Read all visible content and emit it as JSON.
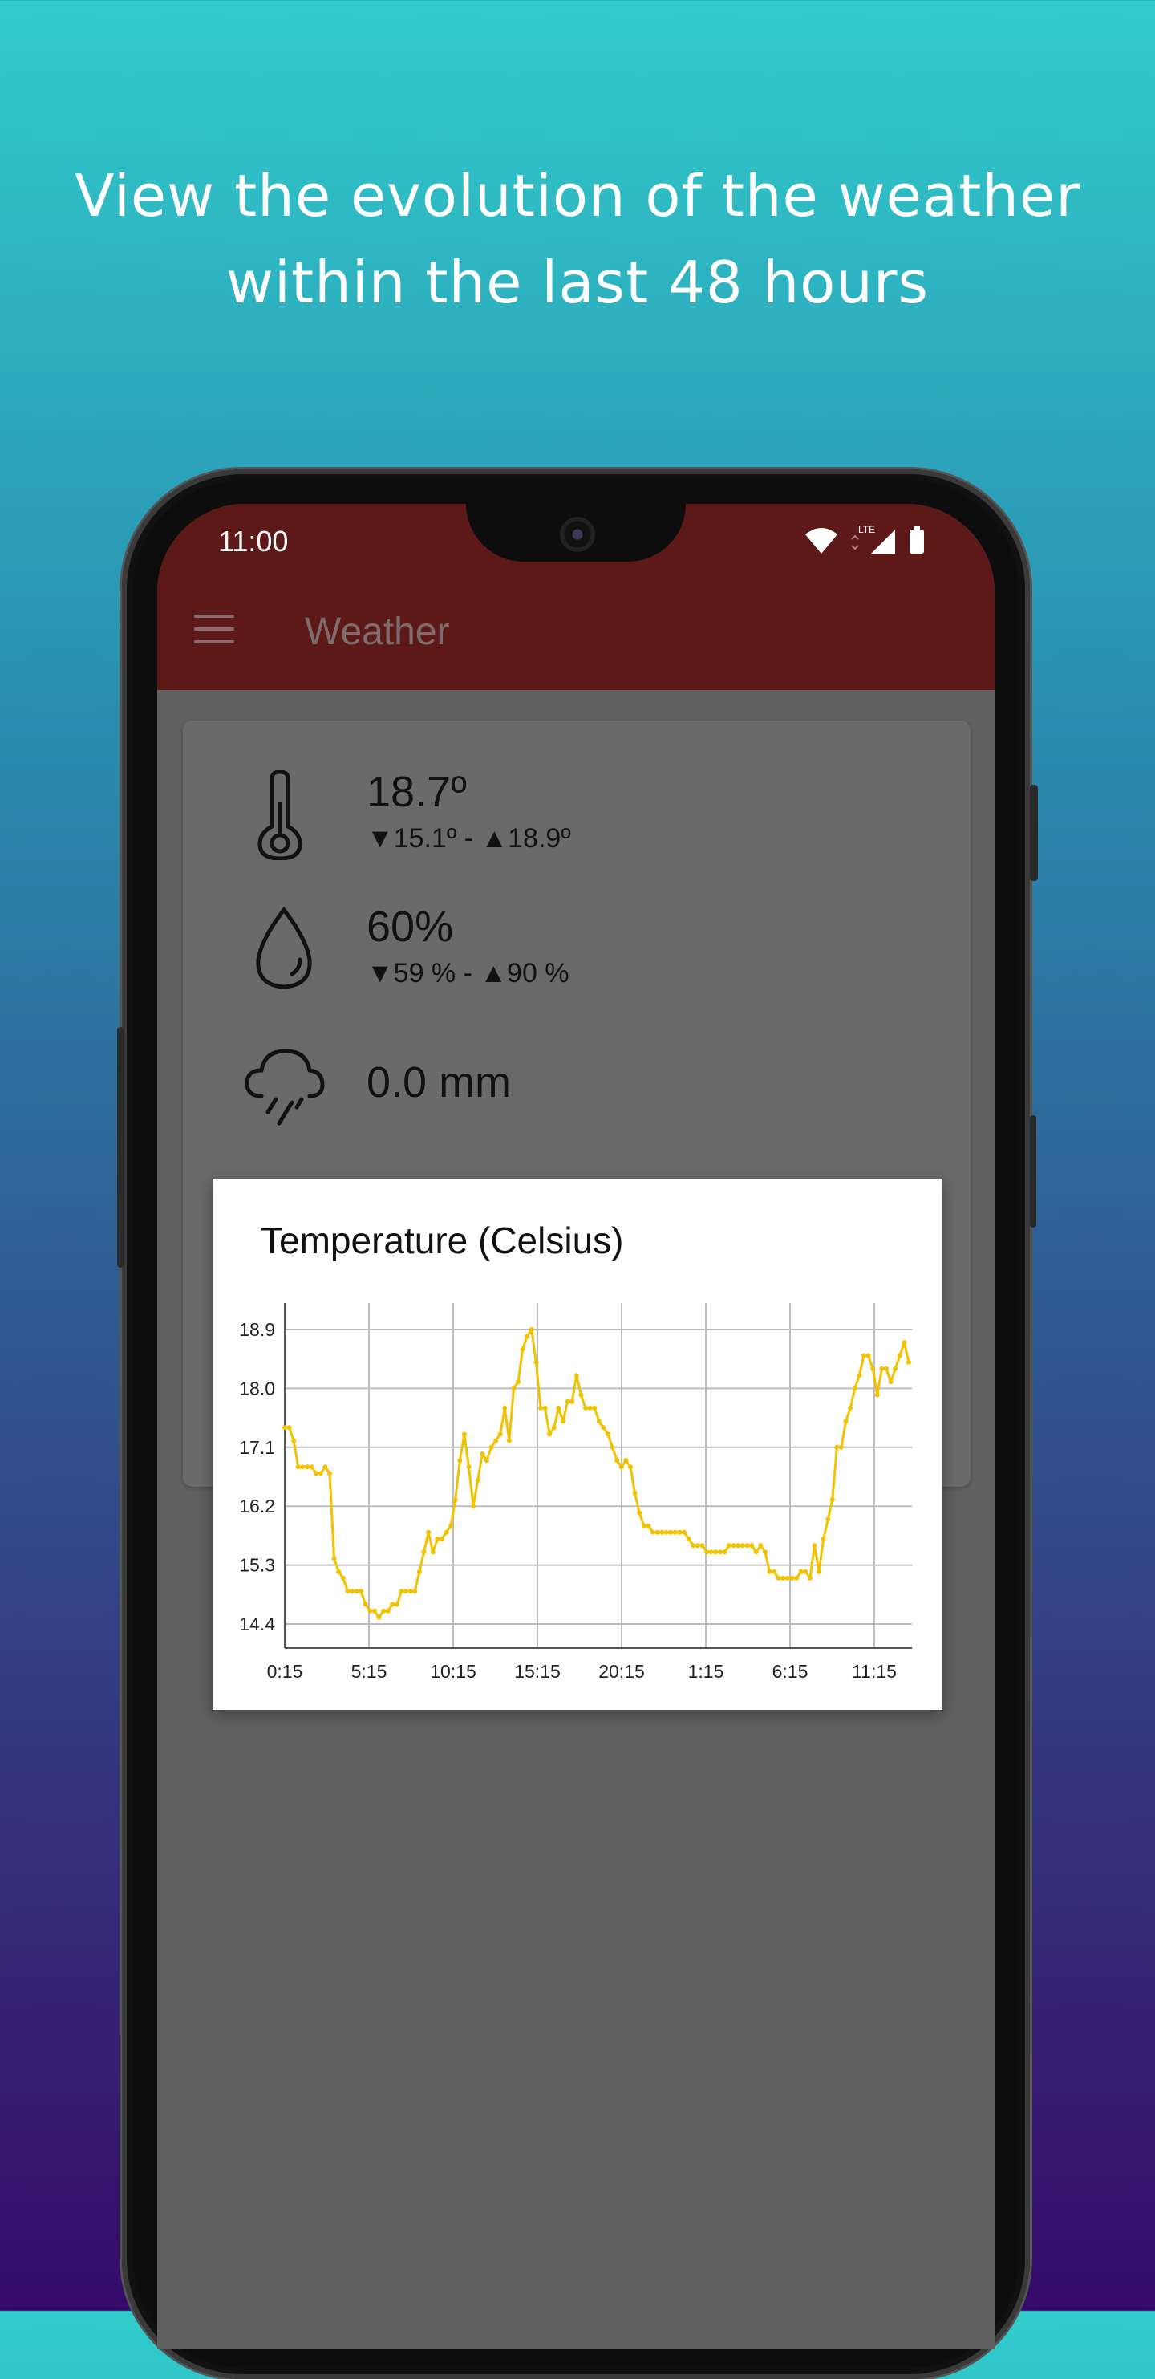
{
  "promo": {
    "headline_line1": "View the evolution of the weather",
    "headline_line2": "within the last 48 hours"
  },
  "status_bar": {
    "time": "11:00",
    "network_label": "LTE"
  },
  "app_bar": {
    "menu_icon": "hamburger-menu-icon",
    "title": "Weather"
  },
  "metrics": {
    "temperature": {
      "icon": "thermometer-icon",
      "value": "18.7º",
      "min": "15.1º",
      "max": "18.9º"
    },
    "humidity": {
      "icon": "water-drop-icon",
      "value": "60%",
      "min": "59 %",
      "max": "90 %"
    },
    "rain": {
      "icon": "rain-cloud-icon",
      "value": "0.0 mm"
    }
  },
  "chart_data": {
    "type": "line",
    "title": "Temperature (Celsius)",
    "y_ticks": [
      "18.9",
      "18.0",
      "17.1",
      "16.2",
      "15.3",
      "14.4"
    ],
    "x_ticks": [
      "0:15",
      "5:15",
      "10:15",
      "15:15",
      "20:15",
      "1:15",
      "6:15",
      "11:15"
    ],
    "ylim": [
      14.4,
      18.9
    ],
    "grid": true,
    "line_color": "#f2c200",
    "series": [
      {
        "values": [
          17.4,
          17.4,
          17.2,
          16.8,
          16.8,
          16.8,
          16.8,
          16.7,
          16.7,
          16.8,
          16.7,
          15.4,
          15.2,
          15.1,
          14.9,
          14.9,
          14.9,
          14.9,
          14.7,
          14.6,
          14.6,
          14.5,
          14.6,
          14.6,
          14.7,
          14.7,
          14.9,
          14.9,
          14.9,
          14.9,
          15.2,
          15.5,
          15.8,
          15.5,
          15.7,
          15.7,
          15.8,
          15.9,
          16.3,
          16.9,
          17.3,
          16.8,
          16.2,
          16.6,
          17.0,
          16.9,
          17.1,
          17.2,
          17.3,
          17.7,
          17.2,
          18.0,
          18.1,
          18.6,
          18.8,
          18.9,
          18.4,
          17.7,
          17.7,
          17.3,
          17.4,
          17.7,
          17.5,
          17.8,
          17.8,
          18.2,
          17.9,
          17.7,
          17.7,
          17.7,
          17.5,
          17.4,
          17.3,
          17.1,
          16.9,
          16.8,
          16.9,
          16.8,
          16.4,
          16.1,
          15.9,
          15.9,
          15.8,
          15.8,
          15.8,
          15.8,
          15.8,
          15.8,
          15.8,
          15.8,
          15.7,
          15.6,
          15.6,
          15.6,
          15.5,
          15.5,
          15.5,
          15.5,
          15.5,
          15.6,
          15.6,
          15.6,
          15.6,
          15.6,
          15.6,
          15.5,
          15.6,
          15.5,
          15.2,
          15.2,
          15.1,
          15.1,
          15.1,
          15.1,
          15.1,
          15.2,
          15.2,
          15.1,
          15.6,
          15.2,
          15.7,
          16.0,
          16.3,
          17.1,
          17.1,
          17.5,
          17.7,
          18.0,
          18.2,
          18.5,
          18.5,
          18.3,
          17.9,
          18.3,
          18.3,
          18.1,
          18.3,
          18.5,
          18.7,
          18.4
        ]
      }
    ]
  }
}
